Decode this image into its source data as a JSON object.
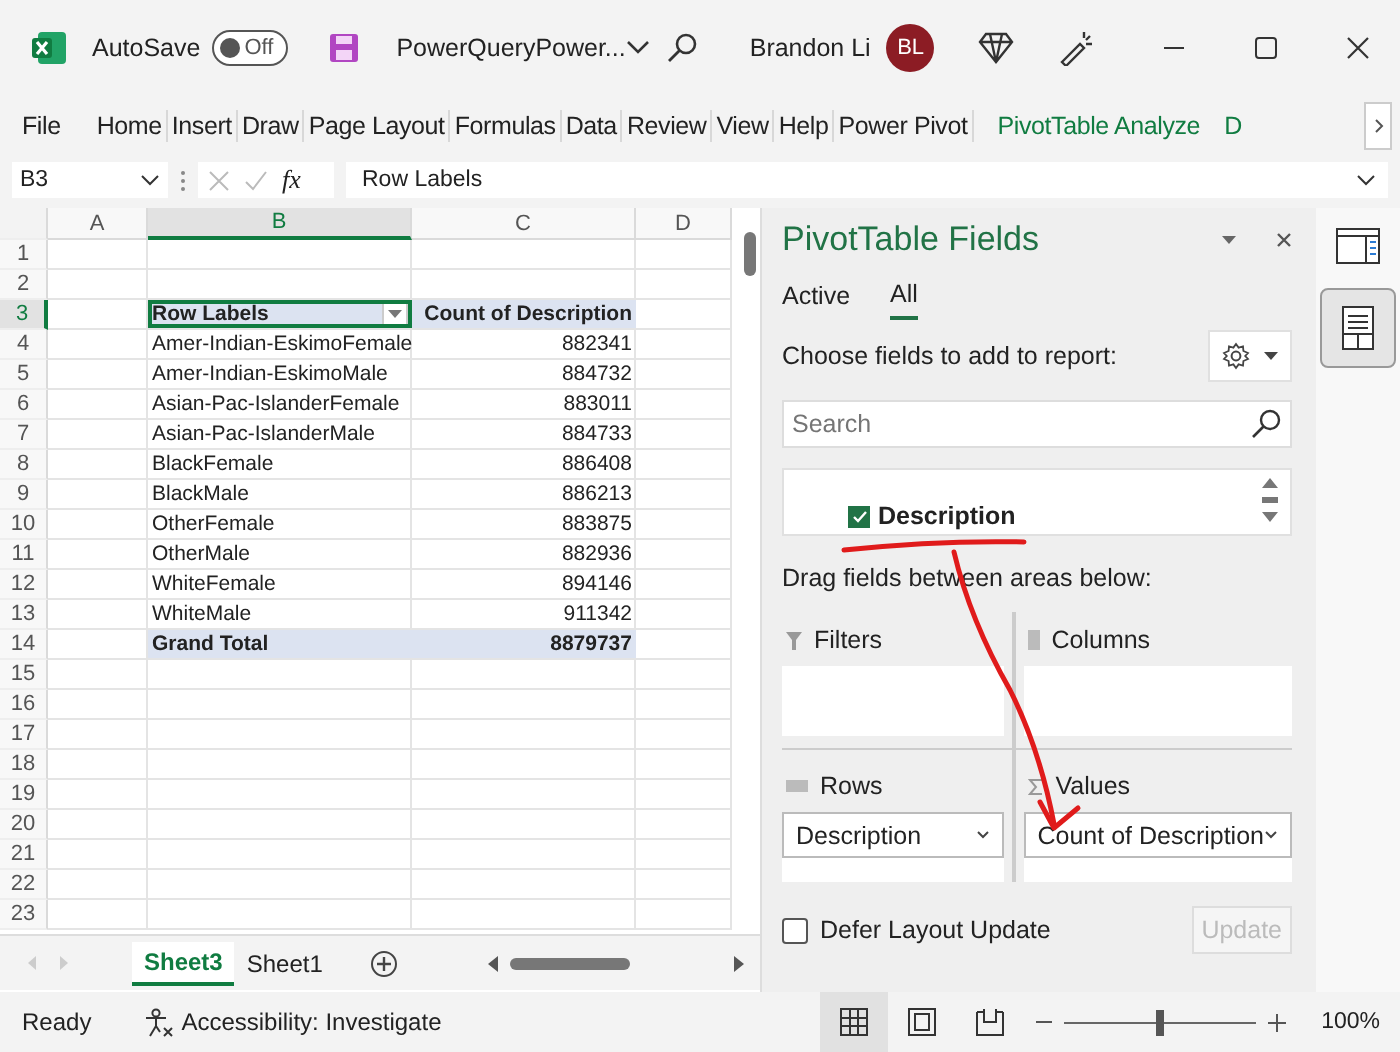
{
  "title_bar": {
    "autosave_label": "AutoSave",
    "autosave_on": false,
    "autosave_state": "Off",
    "file_name": "PowerQueryPower...",
    "user_name": "Brandon Li",
    "avatar_initials": "BL"
  },
  "ribbon_tabs": [
    {
      "label": "File",
      "kind": "normal"
    },
    {
      "label": "Home",
      "kind": "normal"
    },
    {
      "label": "Insert",
      "kind": "normal"
    },
    {
      "label": "Draw",
      "kind": "normal"
    },
    {
      "label": "Page Layout",
      "kind": "normal"
    },
    {
      "label": "Formulas",
      "kind": "normal"
    },
    {
      "label": "Data",
      "kind": "normal"
    },
    {
      "label": "Review",
      "kind": "normal"
    },
    {
      "label": "View",
      "kind": "normal"
    },
    {
      "label": "Help",
      "kind": "normal"
    },
    {
      "label": "Power Pivot",
      "kind": "normal"
    },
    {
      "label": "PivotTable Analyze",
      "kind": "contextual"
    },
    {
      "label": "D",
      "kind": "contextual"
    }
  ],
  "formula_bar": {
    "name_box": "B3",
    "fx": "fx",
    "value": "Row Labels"
  },
  "sheet": {
    "columns": [
      {
        "label": "A",
        "selected": false
      },
      {
        "label": "B",
        "selected": true
      },
      {
        "label": "C",
        "selected": false
      },
      {
        "label": "D",
        "selected": false
      }
    ],
    "rows": [
      {
        "label": "1",
        "selected": false,
        "kind": "empty"
      },
      {
        "label": "2",
        "selected": false,
        "kind": "empty"
      },
      {
        "label": "3",
        "selected": true,
        "kind": "header",
        "text": "Row Labels",
        "value": "Count of Description"
      },
      {
        "label": "4",
        "selected": false,
        "kind": "item",
        "text": "Amer-Indian-EskimoFemale",
        "value": "882341"
      },
      {
        "label": "5",
        "selected": false,
        "kind": "item",
        "text": "Amer-Indian-EskimoMale",
        "value": "884732"
      },
      {
        "label": "6",
        "selected": false,
        "kind": "item",
        "text": "Asian-Pac-IslanderFemale",
        "value": "883011"
      },
      {
        "label": "7",
        "selected": false,
        "kind": "item",
        "text": "Asian-Pac-IslanderMale",
        "value": "884733"
      },
      {
        "label": "8",
        "selected": false,
        "kind": "item",
        "text": "BlackFemale",
        "value": "886408"
      },
      {
        "label": "9",
        "selected": false,
        "kind": "item",
        "text": "BlackMale",
        "value": "886213"
      },
      {
        "label": "10",
        "selected": false,
        "kind": "item",
        "text": "OtherFemale",
        "value": "883875"
      },
      {
        "label": "11",
        "selected": false,
        "kind": "item",
        "text": "OtherMale",
        "value": "882936"
      },
      {
        "label": "12",
        "selected": false,
        "kind": "item",
        "text": "WhiteFemale",
        "value": "894146"
      },
      {
        "label": "13",
        "selected": false,
        "kind": "item",
        "text": "WhiteMale",
        "value": "911342"
      },
      {
        "label": "14",
        "selected": false,
        "kind": "total",
        "text": "Grand Total",
        "value": "8879737"
      },
      {
        "label": "15",
        "selected": false,
        "kind": "empty"
      },
      {
        "label": "16",
        "selected": false,
        "kind": "empty"
      },
      {
        "label": "17",
        "selected": false,
        "kind": "empty"
      },
      {
        "label": "18",
        "selected": false,
        "kind": "empty"
      },
      {
        "label": "19",
        "selected": false,
        "kind": "empty"
      },
      {
        "label": "20",
        "selected": false,
        "kind": "empty"
      },
      {
        "label": "21",
        "selected": false,
        "kind": "empty"
      },
      {
        "label": "22",
        "selected": false,
        "kind": "empty"
      },
      {
        "label": "23",
        "selected": false,
        "kind": "empty"
      }
    ]
  },
  "sheet_tabs": [
    {
      "label": "Sheet3",
      "selected": true
    },
    {
      "label": "Sheet1",
      "selected": false
    }
  ],
  "pivot_panel": {
    "title": "PivotTable Fields",
    "tabs": [
      {
        "label": "Active",
        "selected": false
      },
      {
        "label": "All",
        "selected": true
      }
    ],
    "choose_label": "Choose fields to add to report:",
    "search": {
      "placeholder": "Search"
    },
    "fields": [
      {
        "name": "Description",
        "checked": true
      }
    ],
    "drag_label": "Drag fields between areas below:",
    "areas": [
      {
        "kind": "filters",
        "name": "Filters"
      },
      {
        "kind": "columns",
        "name": "Columns"
      },
      {
        "kind": "rows",
        "name": "Rows",
        "items": [
          "Description"
        ]
      },
      {
        "kind": "values",
        "name": "Values",
        "items": [
          "Count of Description"
        ]
      }
    ],
    "defer": {
      "label": "Defer Layout Update",
      "checked": false
    },
    "update_button": {
      "label": "Update",
      "disabled": true
    }
  },
  "status_bar": {
    "ready": "Ready",
    "accessibility": "Accessibility: Investigate",
    "views": [
      {
        "kind": "normal",
        "selected": true
      },
      {
        "kind": "page_layout",
        "selected": false
      },
      {
        "kind": "page_break",
        "selected": false
      }
    ],
    "zoom": {
      "level": 0.5,
      "reading": "100%"
    }
  }
}
